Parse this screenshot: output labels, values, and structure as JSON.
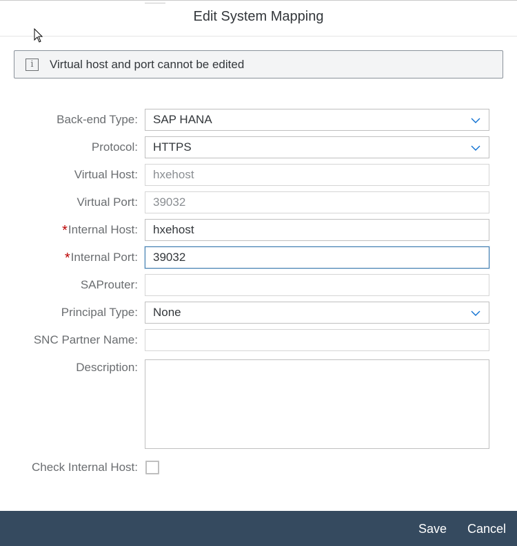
{
  "dialog": {
    "title": "Edit System Mapping"
  },
  "info": {
    "message": "Virtual host and port cannot be edited",
    "icon": "info-icon"
  },
  "form": {
    "backend_type": {
      "label": "Back-end Type:",
      "value": "SAP HANA"
    },
    "protocol": {
      "label": "Protocol:",
      "value": "HTTPS"
    },
    "virtual_host": {
      "label": "Virtual Host:",
      "value": "hxehost"
    },
    "virtual_port": {
      "label": "Virtual Port:",
      "value": "39032"
    },
    "internal_host": {
      "label": "Internal Host:",
      "value": "hxehost",
      "required_mark": "*"
    },
    "internal_port": {
      "label": "Internal Port:",
      "value": "39032",
      "required_mark": "*"
    },
    "saprouter": {
      "label": "SAProuter:",
      "value": ""
    },
    "principal_type": {
      "label": "Principal Type:",
      "value": "None"
    },
    "snc_partner_name": {
      "label": "SNC Partner Name:",
      "value": ""
    },
    "description": {
      "label": "Description:",
      "value": ""
    },
    "check_internal_host": {
      "label": "Check Internal Host:",
      "checked": false
    }
  },
  "footer": {
    "save_label": "Save",
    "cancel_label": "Cancel"
  },
  "colors": {
    "footer_bg": "#354a5f",
    "required": "#bb0000",
    "focus_border": "#427cac",
    "chevron": "#0a6ed1"
  }
}
